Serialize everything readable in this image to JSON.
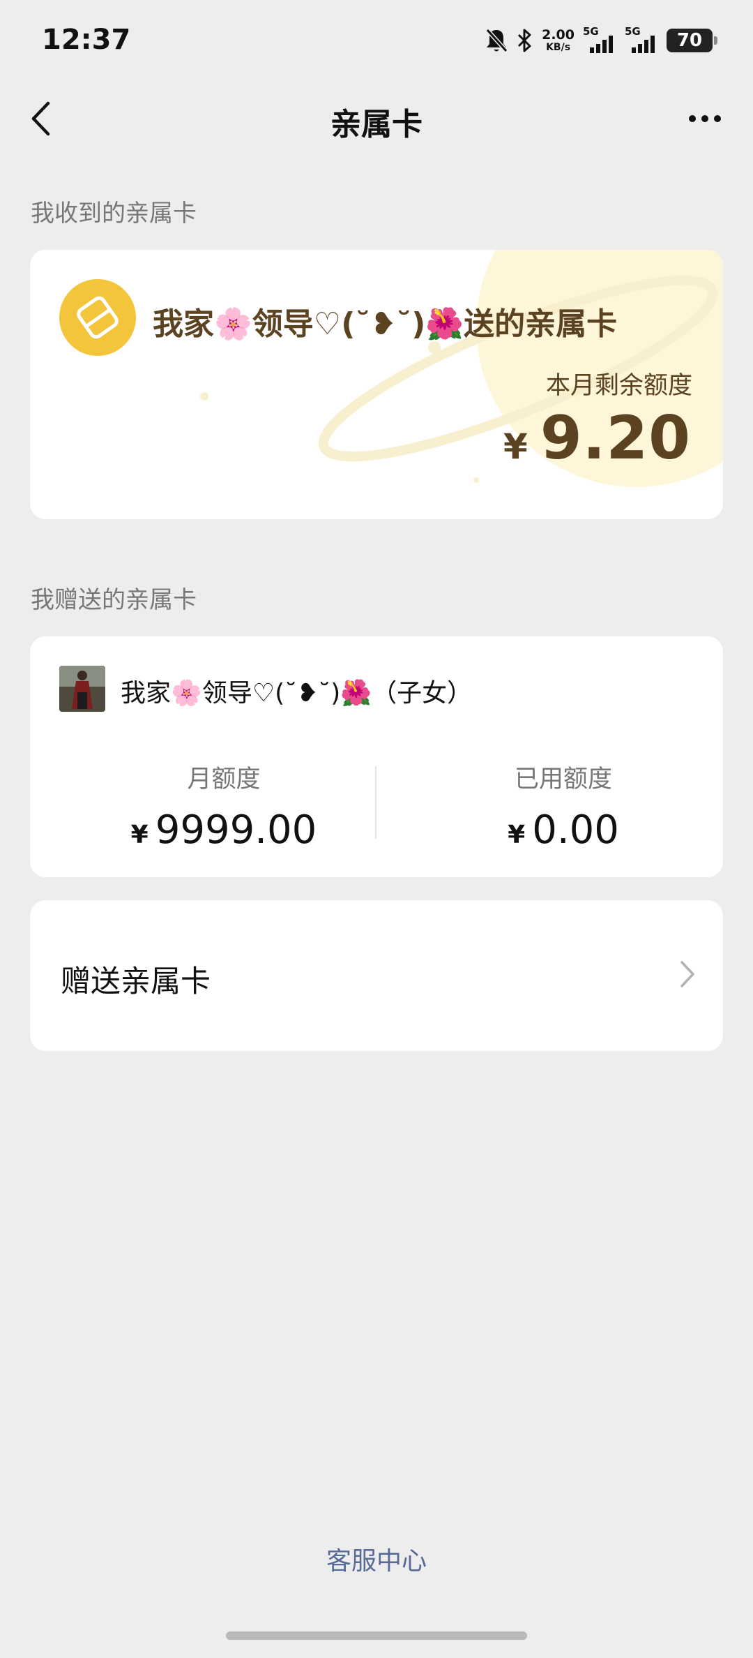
{
  "status_bar": {
    "time": "12:37",
    "net_speed": "2.00",
    "net_unit": "KB/s",
    "sim1_label": "5G",
    "sim2_label": "5G",
    "battery": "70"
  },
  "nav": {
    "title": "亲属卡"
  },
  "received": {
    "section_label": "我收到的亲属卡",
    "card_title": "我家🌸领导♡(˘❥˘)🌺送的亲属卡",
    "remain_label": "本月剩余额度",
    "currency": "¥",
    "remain_amount": "9.20",
    "accent_color": "#f3c53b",
    "text_color": "#5b4220"
  },
  "gifted": {
    "section_label": "我赠送的亲属卡",
    "recipient_name": "我家🌸领导♡(˘❥˘)🌺（子女）",
    "monthly_label": "月额度",
    "monthly_currency": "¥",
    "monthly_amount": "9999.00",
    "used_label": "已用额度",
    "used_currency": "¥",
    "used_amount": "0.00"
  },
  "send_row": {
    "label": "赠送亲属卡"
  },
  "footer": {
    "service_link": "客服中心",
    "link_color": "#576b95"
  }
}
